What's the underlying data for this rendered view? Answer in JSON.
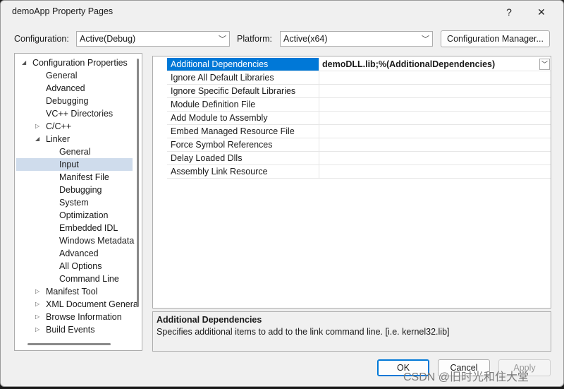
{
  "window": {
    "title": "demoApp Property Pages",
    "help_label": "?",
    "close_label": "✕"
  },
  "config": {
    "configuration_label": "Configuration:",
    "configuration_value": "Active(Debug)",
    "platform_label": "Platform:",
    "platform_value": "Active(x64)",
    "manager_button": "Configuration Manager..."
  },
  "tree": {
    "items": [
      {
        "label": "Configuration Properties",
        "arrow": "◢"
      },
      {
        "label": "General",
        "arrow": ""
      },
      {
        "label": "Advanced",
        "arrow": ""
      },
      {
        "label": "Debugging",
        "arrow": ""
      },
      {
        "label": "VC++ Directories",
        "arrow": ""
      },
      {
        "label": "C/C++",
        "arrow": "▷"
      },
      {
        "label": "Linker",
        "arrow": "◢"
      },
      {
        "label": "General",
        "arrow": ""
      },
      {
        "label": "Input",
        "arrow": ""
      },
      {
        "label": "Manifest File",
        "arrow": ""
      },
      {
        "label": "Debugging",
        "arrow": ""
      },
      {
        "label": "System",
        "arrow": ""
      },
      {
        "label": "Optimization",
        "arrow": ""
      },
      {
        "label": "Embedded IDL",
        "arrow": ""
      },
      {
        "label": "Windows Metadata",
        "arrow": ""
      },
      {
        "label": "Advanced",
        "arrow": ""
      },
      {
        "label": "All Options",
        "arrow": ""
      },
      {
        "label": "Command Line",
        "arrow": ""
      },
      {
        "label": "Manifest Tool",
        "arrow": "▷"
      },
      {
        "label": "XML Document Genera",
        "arrow": "▷"
      },
      {
        "label": "Browse Information",
        "arrow": "▷"
      },
      {
        "label": "Build Events",
        "arrow": "▷"
      }
    ],
    "selected": "Input"
  },
  "properties": [
    {
      "name": "Additional Dependencies",
      "value": "demoDLL.lib;%(AdditionalDependencies)"
    },
    {
      "name": "Ignore All Default Libraries",
      "value": ""
    },
    {
      "name": "Ignore Specific Default Libraries",
      "value": ""
    },
    {
      "name": "Module Definition File",
      "value": ""
    },
    {
      "name": "Add Module to Assembly",
      "value": ""
    },
    {
      "name": "Embed Managed Resource File",
      "value": ""
    },
    {
      "name": "Force Symbol References",
      "value": ""
    },
    {
      "name": "Delay Loaded Dlls",
      "value": ""
    },
    {
      "name": "Assembly Link Resource",
      "value": ""
    }
  ],
  "description": {
    "title": "Additional Dependencies",
    "text": "Specifies additional items to add to the link command line. [i.e. kernel32.lib]"
  },
  "buttons": {
    "ok": "OK",
    "cancel": "Cancel",
    "apply": "Apply"
  },
  "watermark": "CSDN @旧时光和住大堂",
  "colors": {
    "selection": "#0078d7",
    "tree_selection": "#cfdcec"
  }
}
